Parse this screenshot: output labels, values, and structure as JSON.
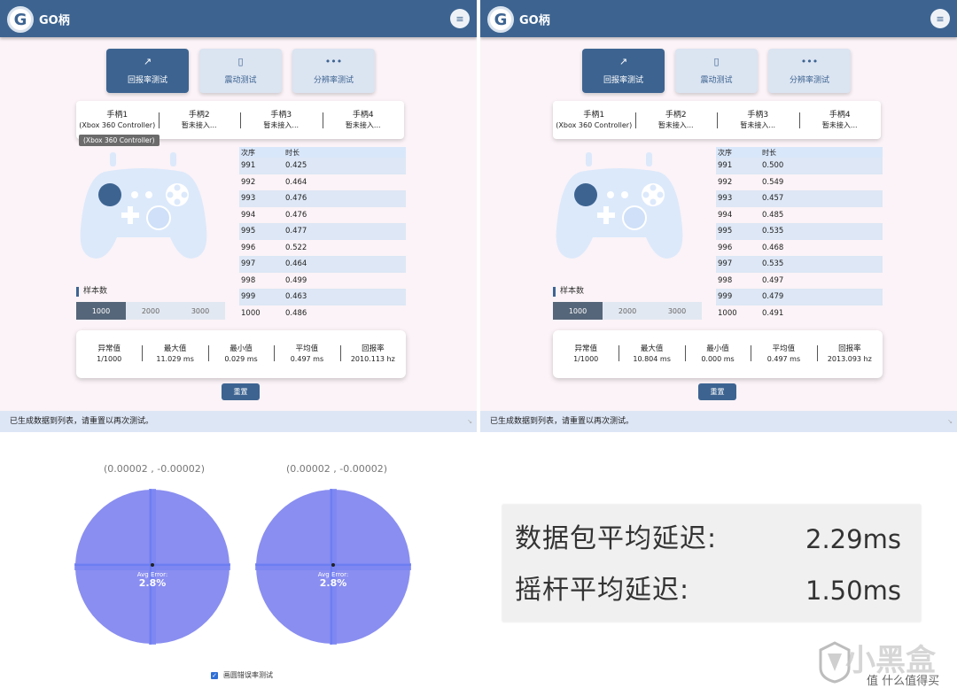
{
  "app": {
    "logo_letter": "G",
    "name": "GO柄"
  },
  "mode_tabs": [
    {
      "label": "回报率测试",
      "icon": "trend-icon"
    },
    {
      "label": "震动测试",
      "icon": "vibrate-icon"
    },
    {
      "label": "分辨率测试",
      "icon": "dots-icon"
    }
  ],
  "controllers": [
    {
      "name": "手柄1",
      "status": "(Xbox 360 Controller)"
    },
    {
      "name": "手柄2",
      "status": "暂未接入..."
    },
    {
      "name": "手柄3",
      "status": "暂未接入..."
    },
    {
      "name": "手柄4",
      "status": "暂未接入..."
    }
  ],
  "tooltip": "(Xbox 360 Controller)",
  "samples": {
    "label": "样本数",
    "options": [
      "1000",
      "2000",
      "3000"
    ],
    "selected": "1000"
  },
  "table_headers": {
    "index": "次序",
    "duration": "时长"
  },
  "left_panel": {
    "rows": [
      {
        "index": "991",
        "duration": "0.425"
      },
      {
        "index": "992",
        "duration": "0.464"
      },
      {
        "index": "993",
        "duration": "0.476"
      },
      {
        "index": "994",
        "duration": "0.476"
      },
      {
        "index": "995",
        "duration": "0.477"
      },
      {
        "index": "996",
        "duration": "0.522"
      },
      {
        "index": "997",
        "duration": "0.464"
      },
      {
        "index": "998",
        "duration": "0.499"
      },
      {
        "index": "999",
        "duration": "0.463"
      },
      {
        "index": "1000",
        "duration": "0.486"
      }
    ],
    "stats": [
      {
        "label": "异常值",
        "value": "1/1000"
      },
      {
        "label": "最大值",
        "value": "11.029 ms"
      },
      {
        "label": "最小值",
        "value": "0.029 ms"
      },
      {
        "label": "平均值",
        "value": "0.497 ms"
      },
      {
        "label": "回报率",
        "value": "2010.113 hz"
      }
    ]
  },
  "right_panel": {
    "rows": [
      {
        "index": "991",
        "duration": "0.500"
      },
      {
        "index": "992",
        "duration": "0.549"
      },
      {
        "index": "993",
        "duration": "0.457"
      },
      {
        "index": "994",
        "duration": "0.485"
      },
      {
        "index": "995",
        "duration": "0.535"
      },
      {
        "index": "996",
        "duration": "0.468"
      },
      {
        "index": "997",
        "duration": "0.535"
      },
      {
        "index": "998",
        "duration": "0.497"
      },
      {
        "index": "999",
        "duration": "0.479"
      },
      {
        "index": "1000",
        "duration": "0.491"
      }
    ],
    "stats": [
      {
        "label": "异常值",
        "value": "1/1000"
      },
      {
        "label": "最大值",
        "value": "10.804 ms"
      },
      {
        "label": "最小值",
        "value": "0.000 ms"
      },
      {
        "label": "平均值",
        "value": "0.497 ms"
      },
      {
        "label": "回报率",
        "value": "2013.093 hz"
      }
    ]
  },
  "reset_label": "重置",
  "status_message": "已生成数据到列表，请重置以再次测试。",
  "stick_test": {
    "left": {
      "coords": "(0.00002 , -0.00002)",
      "error_label": "Avg Error:",
      "error_value": "2.8%"
    },
    "right": {
      "coords": "(0.00002 , -0.00002)",
      "error_label": "Avg Error:",
      "error_value": "2.8%"
    },
    "checkbox_label": "画圆错误率测试",
    "checkbox_checked": true
  },
  "latency": {
    "packet_label": "数据包平均延迟:",
    "packet_value": "2.29ms",
    "stick_label": "摇杆平均延迟:",
    "stick_value": "1.50ms"
  },
  "watermark": {
    "big": "小黑盒",
    "small": "值 什么值得买"
  },
  "colors": {
    "header": "#3d6491",
    "circle_fill": "#8a8ef0",
    "circle_axis": "#5b74f3",
    "controller_body": "#dce9fb",
    "active_sample": "#56667a"
  }
}
